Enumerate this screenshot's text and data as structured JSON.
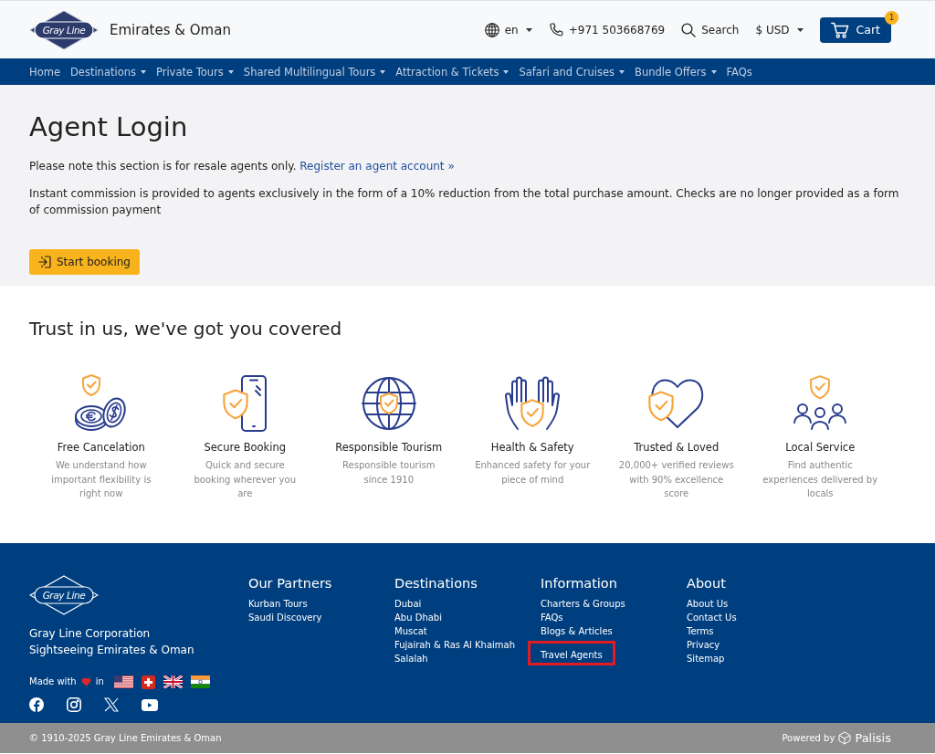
{
  "header": {
    "logo_text": "Gray Line",
    "site_name": "Emirates & Oman",
    "language": "en",
    "phone": "+971 503668769",
    "search_label": "Search",
    "currency": "$ USD",
    "cart_label": "Cart",
    "cart_count": "1"
  },
  "nav": [
    {
      "label": "Home",
      "has_dropdown": false
    },
    {
      "label": "Destinations",
      "has_dropdown": true
    },
    {
      "label": "Private Tours",
      "has_dropdown": true
    },
    {
      "label": "Shared Multilingual Tours",
      "has_dropdown": true
    },
    {
      "label": "Attraction & Tickets",
      "has_dropdown": true
    },
    {
      "label": "Safari and Cruises",
      "has_dropdown": true
    },
    {
      "label": "Bundle Offers",
      "has_dropdown": true
    },
    {
      "label": "FAQs",
      "has_dropdown": false
    }
  ],
  "agent_login": {
    "title": "Agent Login",
    "note": "Please note this section is for resale agents only.",
    "register_link": "Register an agent account »",
    "commission_text": "Instant commission is provided to agents exclusively in the form of a 10% reduction from the total purchase amount. Checks are no longer provided as a form of commission payment",
    "button_label": "Start booking"
  },
  "trust": {
    "title": "Trust in us, we've got you covered",
    "features": [
      {
        "kind": "coins",
        "title": "Free Cancelation",
        "description": "We understand how important flexibility is right now"
      },
      {
        "kind": "phone",
        "title": "Secure Booking",
        "description": "Quick and secure booking wherever you are"
      },
      {
        "kind": "globe",
        "title": "Responsible Tourism",
        "description": "Responsible tourism since 1910"
      },
      {
        "kind": "hands",
        "title": "Health & Safety",
        "description": "Enhanced safety for your piece of mind"
      },
      {
        "kind": "heart",
        "title": "Trusted & Loved",
        "description": "20,000+ verified reviews with 90% excellence score"
      },
      {
        "kind": "people",
        "title": "Local Service",
        "description": "Find authentic experiences delivered by locals"
      }
    ]
  },
  "footer": {
    "logo_text": "Gray Line",
    "company_lines": [
      "Gray Line Corporation",
      "Sightseeing Emirates & Oman"
    ],
    "made_with": "Made with",
    "made_in": "in",
    "columns": [
      {
        "heading": "Our Partners",
        "links": [
          {
            "label": "Kurban Tours",
            "highlighted": false
          },
          {
            "label": "Saudi Discovery",
            "highlighted": false
          }
        ]
      },
      {
        "heading": "Destinations",
        "links": [
          {
            "label": "Dubai",
            "highlighted": false
          },
          {
            "label": "Abu Dhabi",
            "highlighted": false
          },
          {
            "label": "Muscat",
            "highlighted": false
          },
          {
            "label": "Fujairah & Ras Al Khaimah",
            "highlighted": false
          },
          {
            "label": "Salalah",
            "highlighted": false
          }
        ]
      },
      {
        "heading": "Information",
        "links": [
          {
            "label": "Charters & Groups",
            "highlighted": false
          },
          {
            "label": "FAQs",
            "highlighted": false
          },
          {
            "label": "Blogs & Articles",
            "highlighted": false
          },
          {
            "label": "Travel Agents",
            "highlighted": true
          }
        ]
      },
      {
        "heading": "About",
        "links": [
          {
            "label": "About Us",
            "highlighted": false
          },
          {
            "label": "Contact Us",
            "highlighted": false
          },
          {
            "label": "Terms",
            "highlighted": false
          },
          {
            "label": "Privacy",
            "highlighted": false
          },
          {
            "label": "Sitemap",
            "highlighted": false
          }
        ]
      }
    ]
  },
  "bottom_bar": {
    "copyright": "© 1910-2025 Gray Line Emirates & Oman",
    "powered_by": "Powered by",
    "brand": "Palisis"
  }
}
